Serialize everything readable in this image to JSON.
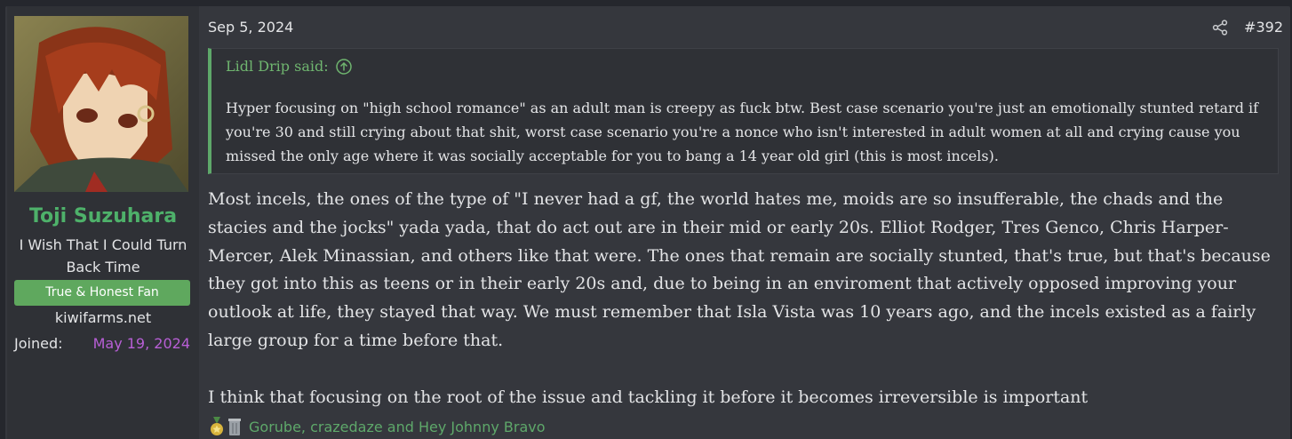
{
  "user": {
    "name": "Toji Suzuhara",
    "title": "I Wish That I Could Turn Back Time",
    "banner": "True & Honest Fan",
    "site": "kiwifarms.net",
    "joined_label": "Joined:",
    "joined_date": "May 19, 2024"
  },
  "post": {
    "date": "Sep 5, 2024",
    "number": "#392",
    "share_icon": "share-icon"
  },
  "quote": {
    "author": "Lidl Drip said:",
    "body": "Hyper focusing on \"high school romance\" as an adult man is creepy as fuck btw. Best case scenario you're just an emotionally stunted retard if you're 30 and still crying about that shit, worst case scenario you're a nonce who isn't interested in adult women at all and crying cause you missed the only age where it was socially acceptable for you to bang a 14 year old girl (this is most incels)."
  },
  "message": {
    "paragraph1": "Most incels, the ones of the type of \"I never had a gf, the world hates me, moids are so insufferable, the chads and the stacies and the jocks\" yada yada, that do act out are in their mid or early 20s. Elliot Rodger, Tres Genco, Chris Harper-Mercer, Alek Minassian, and others like that were. The ones that remain are socially stunted, that's true, but that's because they got into this as teens or in their early 20s and, due to being in an enviroment that actively opposed improving your outlook at life, they stayed that way. We must remember that Isla Vista was 10 years ago, and the incels existed as a fairly large group for a time before that.",
    "paragraph2": "I think that focusing on the root of the issue and tackling it before it becomes irreversible is important"
  },
  "reactions": {
    "names": "Gorube, crazedaze and Hey Johnny Bravo",
    "icons": [
      "medal-icon",
      "trash-can-icon"
    ]
  },
  "colors": {
    "accent_green": "#4eb16a",
    "joined_purple": "#b85fd6",
    "banner_green": "#5fa85e",
    "quote_border": "#5ea86a"
  }
}
